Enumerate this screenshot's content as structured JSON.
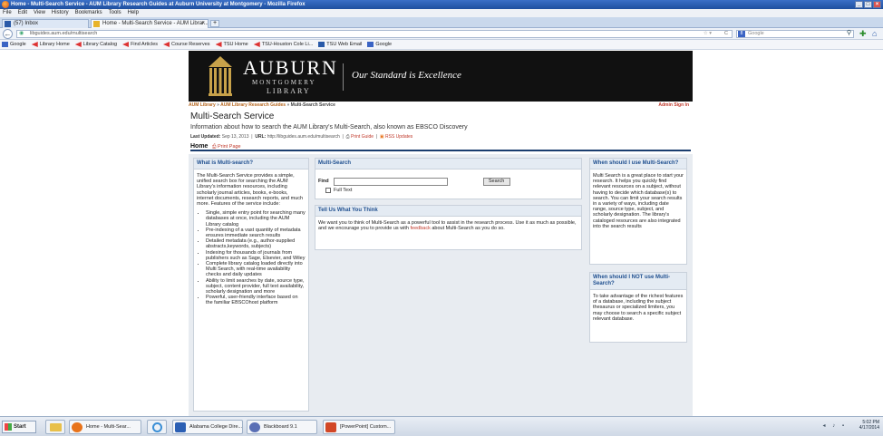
{
  "window": {
    "title": "Home - Multi-Search Service - AUM Library Research Guides at Auburn University at Montgomery - Mozilla Firefox",
    "controls": [
      "_",
      "□",
      "×"
    ]
  },
  "menu": [
    "File",
    "Edit",
    "View",
    "History",
    "Bookmarks",
    "Tools",
    "Help"
  ],
  "tabs": [
    {
      "label": "(57) Inbox",
      "close": ""
    },
    {
      "label": "Home - Multi-Search Service - AUM Librar...",
      "close": "×"
    }
  ],
  "new_tab": "+",
  "nav": {
    "back": "←",
    "url": "libguides.aum.edu/multisearch",
    "star": "☆ ▾",
    "reload": "C",
    "search_engine": "8",
    "search_placeholder": "Google",
    "search_glyph": "⚲"
  },
  "bookmarks": [
    {
      "label": "Google",
      "icon": "google"
    },
    {
      "label": "Library Home",
      "icon": "red"
    },
    {
      "label": "Library Catalog",
      "icon": "red"
    },
    {
      "label": "Find Articles",
      "icon": "red"
    },
    {
      "label": "Course Reserves",
      "icon": "red"
    },
    {
      "label": "TSU Home",
      "icon": "red"
    },
    {
      "label": "TSU-Houston Cole Li...",
      "icon": "red"
    },
    {
      "label": "TSU Web Email",
      "icon": "blue"
    },
    {
      "label": "Google",
      "icon": "google"
    }
  ],
  "header": {
    "name": "AUBURN",
    "sub": "MONTGOMERY",
    "lib": "LIBRARY",
    "tagline": "Our Standard is Excellence"
  },
  "breadcrumb": {
    "items": [
      "AUM Library",
      "AUM Library Research Guides",
      "Multi-Search Service"
    ],
    "sep": "»",
    "admin": "Admin Sign In"
  },
  "guide": {
    "title": "Multi-Search Service",
    "description": "Information about how to search the AUM Library's Multi-Search, also known as EBSCO Discovery",
    "last_updated_label": "Last Updated:",
    "last_updated": "Sep 13, 2013",
    "url_label": "URL:",
    "url": "http://libguides.aum.edu/multisearch",
    "print_guide": "Print Guide",
    "rss": "RSS Updates"
  },
  "page_tabs": {
    "home": "Home",
    "print": "Print Page"
  },
  "boxes": {
    "what": {
      "title": "What is Multi-search?",
      "intro": "The Multi-Search Service provides a simple, unified search box for searching the AUM Library's information resources, including scholarly journal articles, books, e-books, internet documents, research reports, and much more. Features of the service include:",
      "bullets": [
        "Single, simple entry point for searching many databases at once, including the AUM Library catalog",
        "Pre-indexing of a vast quantity of metadata ensures immediate search results",
        "Detailed metadata (e.g., author-supplied abstracts,keywords, subjects)",
        "Indexing for thousands of journals from publishers such as Sage, Elsevier, and Wiley",
        "Complete library catalog loaded directly into Multi Search, with real-time availability checks and daily updates",
        "Ability to limit searches by date, source type, subject, content provider, full text availability, scholarly designation and more",
        "Powerful, user-friendly interface based on the familiar EBSCOhost platform"
      ]
    },
    "multi": {
      "title": "Multi-Search",
      "find_label": "Find",
      "search_button": "Search",
      "full_text_label": "Full Text"
    },
    "tell": {
      "title": "Tell Us What You Think",
      "text_before": "We want you to think of Multi-Search as a powerful tool to assist in the research process. Use it as much as possible, and we encourage you to provide us with ",
      "link": "feedback",
      "text_after": " about Multi-Search as you do so."
    },
    "when": {
      "title": "When should I use Multi-Search?",
      "text": "Multi Search is a great place to start your research. It helps you quickly find relevant resources on a subject, without having to decide which database(s) to search. You can limit your search results in a variety of ways, including date range, source type, subject, and scholarly designation. The library's cataloged resources are also integrated into the search results"
    },
    "whennot": {
      "title": "When should I NOT use Multi-Search?",
      "text": "To take advantage of the richest features of a database, including the subject thesaurus or specialized limiters, you may choose to search a specific subject relevant database."
    }
  },
  "taskbar": {
    "start": "Start",
    "items": [
      {
        "label": "Home - Multi-Sear...",
        "color": "#e8731a"
      },
      {
        "label": "Alabama College Dire...",
        "color": "#2b5fb4"
      },
      {
        "label": "Blackboard 9.1",
        "color": "#5a6fb5"
      },
      {
        "label": "[PowerPoint] Custom...",
        "color": "#d24726"
      }
    ],
    "tray_icons": "◂ ♪ ▪",
    "time": "5:02 PM",
    "date": "4/17/2014"
  }
}
